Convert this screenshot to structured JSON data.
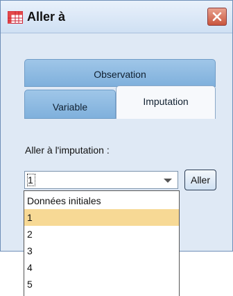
{
  "window": {
    "title": "Aller à",
    "app_icon": "table-grid-icon",
    "close_icon": "close-x-icon"
  },
  "tabs": [
    {
      "label": "Observation"
    },
    {
      "label": "Variable"
    },
    {
      "label": "Imputation",
      "active": true
    }
  ],
  "form": {
    "label": "Aller à l'imputation :",
    "combo_value": "1",
    "button_label": "Aller"
  },
  "dropdown": {
    "options": [
      "Données initiales",
      "1",
      "2",
      "3",
      "4",
      "5"
    ],
    "selected_index": 1
  },
  "colors": {
    "tab": "#8fbce3",
    "selected_option": "#f7d995",
    "window_bg": "#dfe9f5"
  }
}
